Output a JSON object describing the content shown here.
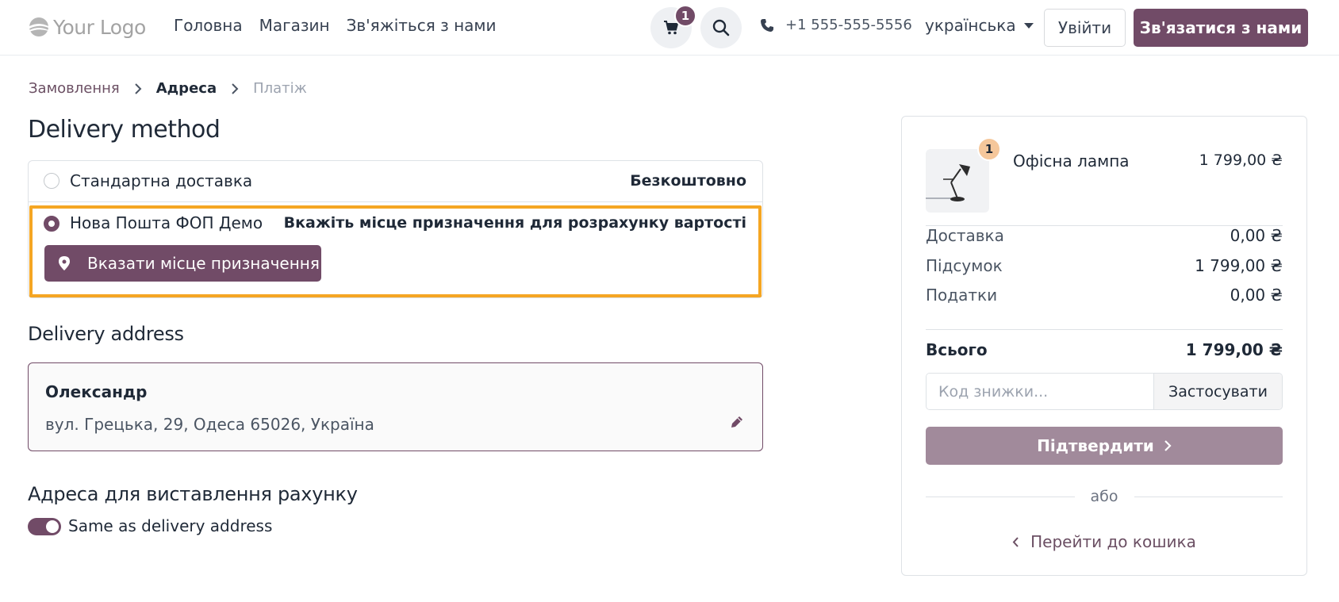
{
  "header": {
    "logo_text": "Your Logo",
    "nav": [
      {
        "label": "Головна"
      },
      {
        "label": "Магазин"
      },
      {
        "label": "Зв'яжіться з нами"
      }
    ],
    "cart_count": "1",
    "phone": "+1 555-555-5556",
    "language": "українська",
    "login_label": "Увійти",
    "contact_label": "Зв'язатися з нами"
  },
  "breadcrumb": {
    "step1": "Замовлення",
    "step2": "Адреса",
    "step3": "Платіж"
  },
  "delivery_method": {
    "title": "Delivery method",
    "options": [
      {
        "label": "Стандартна доставка",
        "price": "Безкоштовно",
        "selected": false
      },
      {
        "label": "Нова Пошта ФОП Демо",
        "price": "Вкажіть місце призначення для розрахунку вартості",
        "selected": true
      }
    ],
    "destination_button": "Вказати місце призначення"
  },
  "delivery_address": {
    "title": "Delivery address",
    "name": "Олександр",
    "address": "вул. Грецька, 29, Одеса 65026, Україна"
  },
  "billing": {
    "title": "Адреса для виставлення рахунку",
    "same_as_label": "Same as delivery address",
    "same_as_enabled": true
  },
  "summary": {
    "product": {
      "name": "Офісна лампа",
      "price": "1 799,00 ₴",
      "quantity": "1"
    },
    "rows": [
      {
        "label": "Доставка",
        "value": "0,00 ₴"
      },
      {
        "label": "Підсумок",
        "value": "1 799,00 ₴"
      },
      {
        "label": "Податки",
        "value": "0,00 ₴"
      }
    ],
    "total_label": "Всього",
    "total_value": "1 799,00 ₴",
    "coupon_placeholder": "Код знижки...",
    "apply_label": "Застосувати",
    "confirm_label": "Підтвердити",
    "or_label": "або",
    "back_label": "Перейти до кошика"
  },
  "colors": {
    "brand": "#714b67",
    "highlight": "#f5a623",
    "confirm_disabled": "#a18a9b"
  }
}
